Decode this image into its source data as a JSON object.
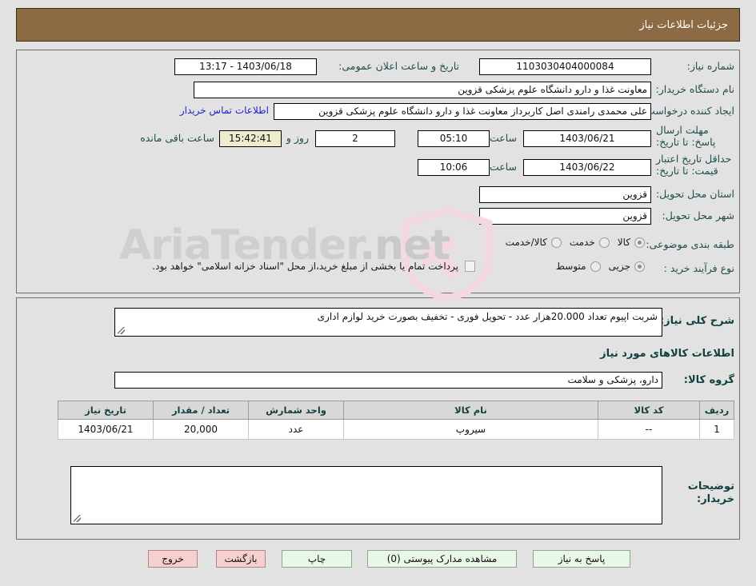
{
  "header": {
    "title": "جزئیات اطلاعات نیاز"
  },
  "watermark": {
    "text": "AriaTender",
    "suffix": ".net"
  },
  "form": {
    "need_number_label": "شماره نیاز:",
    "need_number_value": "1103030404000084",
    "announce_label": "تاریخ و ساعت اعلان عمومی:",
    "announce_value": "1403/06/18 - 13:17",
    "buyer_org_label": "نام دستگاه خریدار:",
    "buyer_org_value": "معاونت غذا و دارو دانشگاه علوم پزشکی قزوین",
    "creator_label": "ایجاد کننده درخواست:",
    "creator_value": "علی محمدی رامندی اصل کاربرداز معاونت غذا و دارو دانشگاه علوم پزشکی قزوین",
    "contact_link": "اطلاعات تماس خریدار",
    "deadline_label": "مهلت ارسال پاسخ: تا تاریخ:",
    "deadline_date": "1403/06/21",
    "deadline_time_label": "ساعت",
    "deadline_time": "05:10",
    "remaining_days": "2",
    "remaining_days_label": "روز و",
    "remaining_clock": "15:42:41",
    "remaining_clock_label": "ساعت باقی مانده",
    "valid_label": "حداقل تاریخ اعتبار قیمت: تا تاریخ:",
    "valid_date": "1403/06/22",
    "valid_time_label": "ساعت",
    "valid_time": "10:06",
    "province_label": "استان محل تحویل:",
    "province_value": "قزوین",
    "city_label": "شهر محل تحویل:",
    "city_value": "قزوین",
    "category_label": "طبقه بندی موضوعی:",
    "category_options": [
      "کالا",
      "خدمت",
      "کالا/خدمت"
    ],
    "category_selected": "کالا",
    "process_label": "نوع فرآیند خرید :",
    "process_options": [
      "جزیی",
      "متوسط"
    ],
    "process_selected": "جزیی",
    "treasury_note": "پرداخت تمام یا بخشی از مبلغ خرید،از محل \"اسناد خزانه اسلامی\" خواهد بود.",
    "treasury_checked": false
  },
  "description": {
    "label": "شرح کلی نیاز:",
    "value": "شربت اپیوم   تعداد 20.000هزار عدد - تحویل فوری - تخفیف بصورت خرید لوازم اداری"
  },
  "goods": {
    "section_title": "اطلاعات کالاهای مورد نیاز",
    "group_label": "گروه کالا:",
    "group_value": "دارو، پزشکی و سلامت",
    "columns": [
      "ردیف",
      "کد کالا",
      "نام کالا",
      "واحد شمارش",
      "تعداد / مقدار",
      "تاریخ نیاز"
    ],
    "rows": [
      {
        "index": "1",
        "code": "--",
        "name": "سیروپ",
        "unit": "عدد",
        "quantity": "20,000",
        "need_date": "1403/06/21"
      }
    ]
  },
  "buyer_notes": {
    "label": "توضیحات خریدار:",
    "value": ""
  },
  "footer": {
    "respond": "پاسخ به نیاز",
    "attachments": "مشاهده مدارک پیوستی (0)",
    "print": "چاپ",
    "back": "بازگشت",
    "exit": "خروج"
  },
  "colors": {
    "header_bar": "#8c6a43",
    "page_bg": "#e2e2e2",
    "label_teal": "#1f4e4e",
    "link_blue": "#1f1fd0",
    "highlight_yellow": "#efeccd",
    "btn_green": "#e9f7e9",
    "btn_pink": "#f6cfcf"
  }
}
